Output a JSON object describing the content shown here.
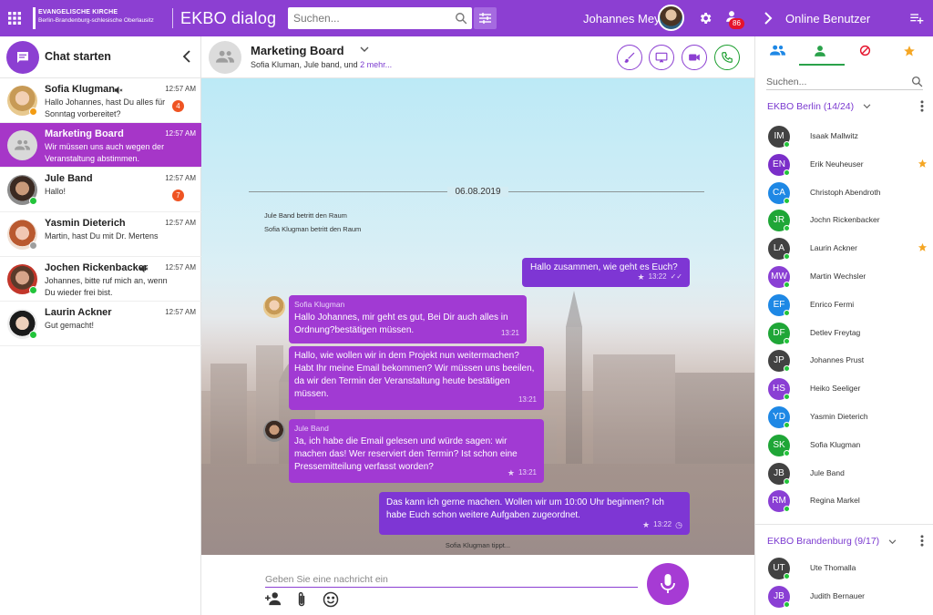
{
  "topbar": {
    "brand_line1": "EVANGELISCHE KIRCHE",
    "brand_line2": "Berlin-Brandenburg-schlesische Oberlausitz",
    "app_title": "EKBO dialog",
    "search_placeholder": "Suchen...",
    "user_name": "Johannes Meyer",
    "notification_count": "86",
    "right_panel_title": "Online Benutzer"
  },
  "left": {
    "chat_start_label": "Chat starten",
    "chats": [
      {
        "name": "Sofia Klugman",
        "time": "12:57 AM",
        "message": "Hallo Johannes, hast Du alles für Sonntag vorbereitet?",
        "badge": "4",
        "muted": true,
        "status": "#f39c12"
      },
      {
        "name": "Marketing Board",
        "time": "12:57 AM",
        "message": "Wir müssen uns auch wegen der Veranstaltung abstimmen.",
        "active": true
      },
      {
        "name": "Jule Band",
        "time": "12:57 AM",
        "message": "Hallo!",
        "badge": "7",
        "status": "#22c43a"
      },
      {
        "name": "Yasmin Dieterich",
        "time": "12:57 AM",
        "message": "Martin, hast Du mit Dr. Mertens",
        "status": "#9e9e9e"
      },
      {
        "name": "Jochen Rickenbacker",
        "time": "12:57 AM",
        "message": "Johannes, bitte ruf mich an, wenn Du wieder frei bist.",
        "muted": true,
        "status": "#22c43a"
      },
      {
        "name": "Laurin Ackner",
        "time": "12:57 AM",
        "message": "Gut gemacht!",
        "status": "#22c43a"
      }
    ]
  },
  "chat": {
    "title": "Marketing Board",
    "members": "Sofia Kluman, Jule band, und",
    "more_link": "2 mehr...",
    "date": "06.08.2019",
    "system_messages": [
      "Jule Band betritt den Raum",
      "Sofia Klugman betritt den Raum"
    ],
    "messages": [
      {
        "text": "Hallo zusammen, wie geht es Euch?",
        "time": "13:22"
      },
      {
        "sender": "Sofia Klugman",
        "text": "Hallo Johannes, mir geht es gut, Bei Dir auch alles in Ordnung?bestätigen müssen.",
        "time": "13:21"
      },
      {
        "text": "Hallo, wie wollen wir in dem Projekt nun weitermachen? Habt Ihr meine Email bekommen? Wir müssen uns beeilen, da wir den Termin der Veranstaltung heute bestätigen müssen.",
        "time": "13:21"
      },
      {
        "sender": "Jule Band",
        "text": "Ja, ich habe die Email gelesen und würde sagen: wir machen das! Wer reserviert den Termin? Ist schon eine Pressemitteilung verfasst worden?",
        "time": "13:21"
      },
      {
        "text": "Das kann ich gerne machen. Wollen wir um 10:00 Uhr beginnen? Ich habe Euch schon weitere Aufgaben zugeordnet.",
        "time": "13:22"
      }
    ],
    "typing": "Sofia Klugman tippt...",
    "composer_placeholder": "Geben Sie eine nachricht ein"
  },
  "right": {
    "search_placeholder": "Suchen...",
    "groups": [
      {
        "title": "EKBO Berlin (14/24)",
        "members": [
          {
            "initials": "IM",
            "name": "Isaak Mallwitz",
            "color": "#424242"
          },
          {
            "initials": "EN",
            "name": "Erik Neuheuser",
            "color": "#7b2fc9",
            "star": true
          },
          {
            "initials": "CA",
            "name": "Christoph Abendroth",
            "color": "#1e88e5"
          },
          {
            "initials": "JR",
            "name": "Jochn Rickenbacker",
            "color": "#1fa637"
          },
          {
            "initials": "LA",
            "name": "Laurin Ackner",
            "color": "#424242",
            "star": true
          },
          {
            "initials": "MW",
            "name": "Martin Wechsler",
            "color": "#8a3fd4"
          },
          {
            "initials": "EF",
            "name": "Enrico Fermi",
            "color": "#1e88e5"
          },
          {
            "initials": "DF",
            "name": "Detlev Freytag",
            "color": "#1fa637"
          },
          {
            "initials": "JP",
            "name": "Johannes Prust",
            "color": "#424242"
          },
          {
            "initials": "HS",
            "name": "Heiko Seeliger",
            "color": "#8a3fd4"
          },
          {
            "initials": "YD",
            "name": "Yasmin Dieterich",
            "color": "#1e88e5"
          },
          {
            "initials": "SK",
            "name": "Sofia Klugman",
            "color": "#1fa637"
          },
          {
            "initials": "JB",
            "name": "Jule Band",
            "color": "#424242"
          },
          {
            "initials": "RM",
            "name": "Regina Markel",
            "color": "#8a3fd4"
          }
        ]
      },
      {
        "title": "EKBO Brandenburg (9/17)",
        "members": [
          {
            "initials": "UT",
            "name": "Ute Thomalla",
            "color": "#424242"
          },
          {
            "initials": "JB",
            "name": "Judith Bernauer",
            "color": "#8a3fd4"
          }
        ]
      }
    ]
  },
  "colors": {
    "brand": "#8c3fd2",
    "bubble_in": "#a13ad3",
    "bubble_out": "#7e36d4",
    "online": "#22c43a",
    "star": "#f5a623",
    "badge": "#ef5423"
  }
}
